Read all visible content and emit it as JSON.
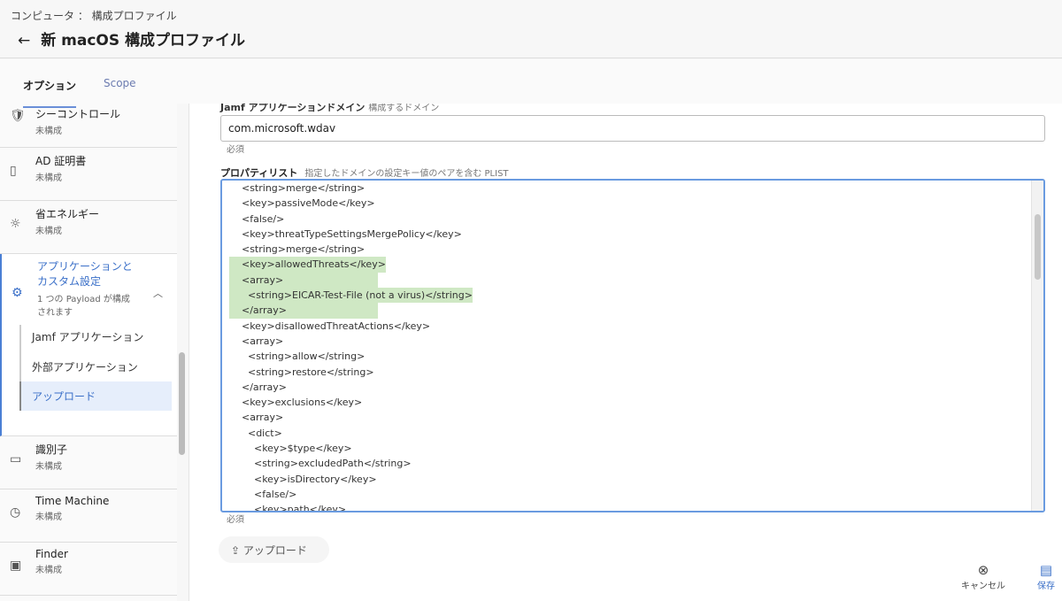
{
  "header": {
    "breadcrumb": "コンピュータ ： 構成プロファイル",
    "back_icon": "←",
    "title": "新 macOS 構成プロファイル"
  },
  "tabs": [
    {
      "label": "オプション"
    },
    {
      "label": "Scope"
    }
  ],
  "sidebar": {
    "items": [
      {
        "name": "シーコントロール",
        "status": "未構成",
        "icon": "🛡"
      },
      {
        "name": "AD 証明書",
        "status": "未構成",
        "icon": "▯"
      },
      {
        "name": "省エネルギー",
        "status": "未構成",
        "icon": "☼"
      },
      {
        "name": "アプリケーションと\nカスタム設定",
        "status": "1 つの Payload が構成されます",
        "icon": "⚙"
      },
      {
        "name": "識別子",
        "status": "未構成",
        "icon": "▭"
      },
      {
        "name": "Time Machine",
        "status": "未構成",
        "icon": "◷"
      },
      {
        "name": "Finder",
        "status": "未構成",
        "icon": "▣"
      }
    ],
    "subitems": [
      "Jamf アプリケーション",
      "外部アプリケーション",
      "アップロード"
    ]
  },
  "main": {
    "domain_label": "Jamf アプリケーションドメイン",
    "domain_hint": "構成するドメイン",
    "domain_value": "com.microsoft.wdav",
    "required": "必須",
    "plist_label": "プロパティリスト",
    "plist_hint": "指定したドメインの設定キー値のペアを含む PLIST",
    "plist_lines": [
      {
        "t": "    <string>merge</string>"
      },
      {
        "t": "    <key>passiveMode</key>"
      },
      {
        "t": "    <false/>"
      },
      {
        "t": "    <key>threatTypeSettingsMergePolicy</key>"
      },
      {
        "t": "    <string>merge</string>"
      },
      {
        "t": "    <key>allowedThreats</key>",
        "hl": true
      },
      {
        "t": "    <array>",
        "hl": true
      },
      {
        "t": "      <string>EICAR-Test-File (not a virus)</string>",
        "hl": true
      },
      {
        "t": "    </array>",
        "hl": true
      },
      {
        "t": "    <key>disallowedThreatActions</key>"
      },
      {
        "t": "    <array>"
      },
      {
        "t": "      <string>allow</string>"
      },
      {
        "t": "      <string>restore</string>"
      },
      {
        "t": "    </array>"
      },
      {
        "t": "    <key>exclusions</key>"
      },
      {
        "t": "    <array>"
      },
      {
        "t": "      <dict>"
      },
      {
        "t": "        <key>$type</key>"
      },
      {
        "t": "        <string>excludedPath</string>"
      },
      {
        "t": "        <key>isDirectory</key>"
      },
      {
        "t": "        <false/>"
      },
      {
        "t": "        <key>path</key>"
      }
    ],
    "upload_label": "アップロード"
  },
  "footer": {
    "cancel": "キャンセル",
    "save": "保存"
  },
  "colors": {
    "accent": "#3a6fc8",
    "highlight": "#cfe8c4"
  }
}
